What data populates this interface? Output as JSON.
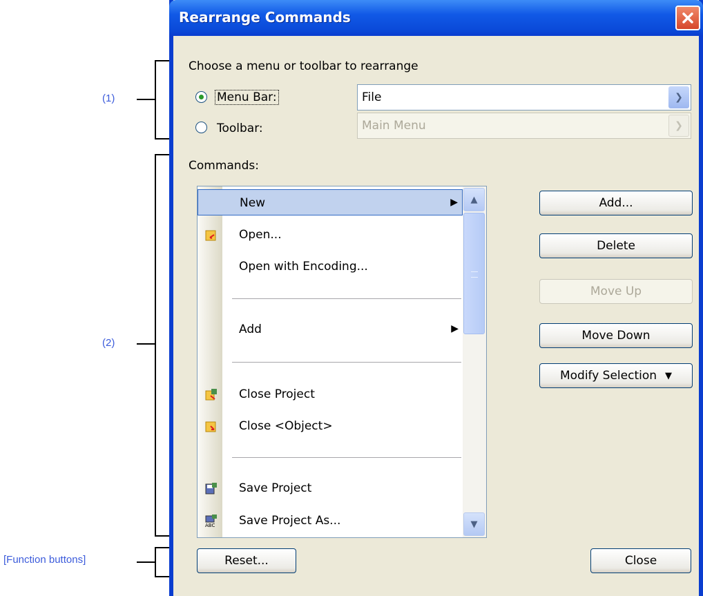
{
  "annotations": {
    "a1": "(1)",
    "a2": "(2)",
    "a3": "[Function buttons]"
  },
  "window": {
    "title": "Rearrange Commands",
    "close_icon": "close-icon"
  },
  "chooser": {
    "heading": "Choose a menu or toolbar to rearrange",
    "menubar_label": "Menu Bar:",
    "menubar_selected": true,
    "menubar_value": "File",
    "toolbar_label": "Toolbar:",
    "toolbar_selected": false,
    "toolbar_value": "Main Menu"
  },
  "commands": {
    "label": "Commands:",
    "items": [
      {
        "label": "New",
        "submenu": true,
        "icon": null,
        "selected": true
      },
      {
        "label": "Open...",
        "icon": "open-folder-icon"
      },
      {
        "label": "Open with Encoding...",
        "icon": null
      },
      {
        "label": "Add",
        "submenu": true,
        "icon": null
      },
      {
        "label": "Close Project",
        "icon": "close-project-icon"
      },
      {
        "label": "Close <Object>",
        "icon": "close-object-icon"
      },
      {
        "label": "Save Project",
        "icon": "save-project-icon"
      },
      {
        "label": "Save Project As...",
        "icon": "save-project-as-icon"
      }
    ]
  },
  "buttons": {
    "add": "Add...",
    "delete": "Delete",
    "move_up": "Move Up",
    "move_down": "Move Down",
    "modify_selection": "Modify Selection",
    "reset": "Reset...",
    "close": "Close"
  }
}
